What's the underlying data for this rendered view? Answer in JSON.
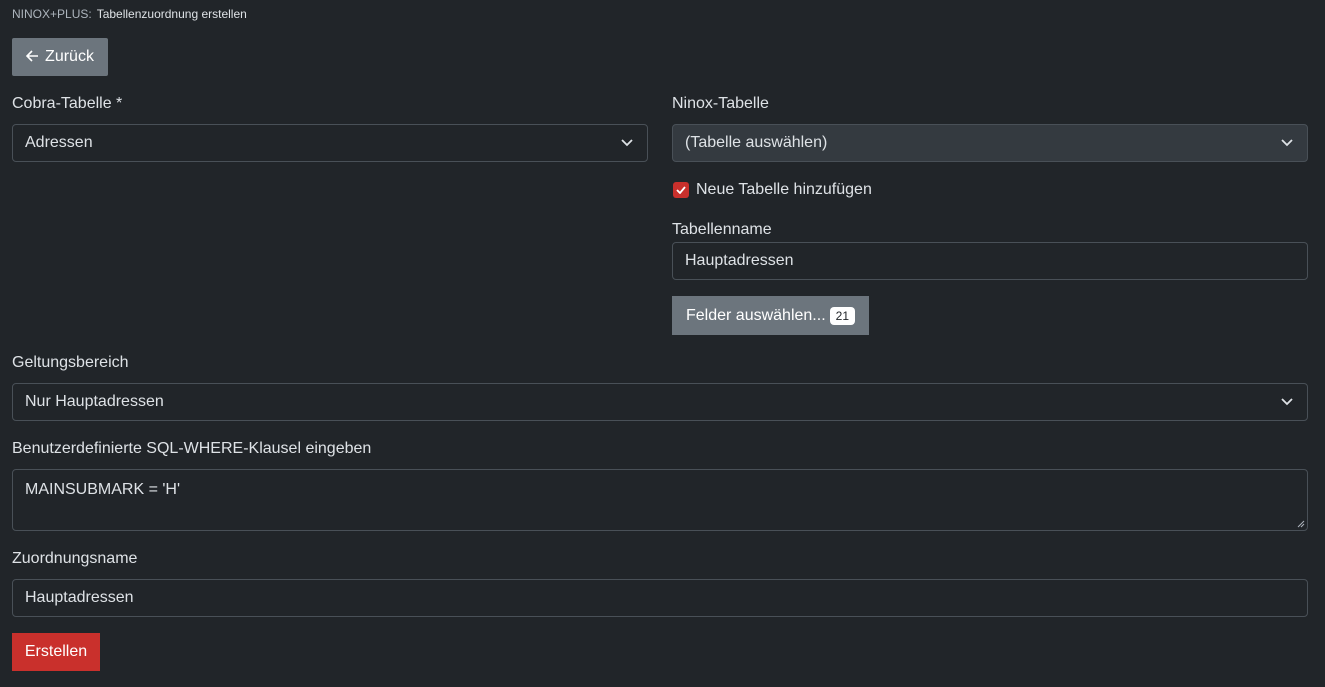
{
  "breadcrumb": {
    "app": "NINOX+PLUS:",
    "title": "Tabellenzuordnung erstellen"
  },
  "back_button": {
    "label": "Zurück",
    "icon": "arrow-left-icon"
  },
  "cobra_table": {
    "label": "Cobra-Tabelle *",
    "selected": "Adressen"
  },
  "ninox_table": {
    "label": "Ninox-Tabelle",
    "selected": "(Tabelle auswählen)"
  },
  "new_table_checkbox": {
    "label": "Neue Tabelle hinzufügen",
    "checked": true
  },
  "table_name": {
    "label": "Tabellenname",
    "value": "Hauptadressen"
  },
  "fields_button": {
    "label": "Felder auswählen...",
    "count": "21"
  },
  "scope": {
    "label": "Geltungsbereich",
    "selected": "Nur Hauptadressen"
  },
  "sql_where": {
    "label": "Benutzerdefinierte SQL-WHERE-Klausel eingeben",
    "value": "MAINSUBMARK = 'H'"
  },
  "mapping_name": {
    "label": "Zuordnungsname",
    "value": "Hauptadressen"
  },
  "create_button": {
    "label": "Erstellen"
  },
  "colors": {
    "background": "#212529",
    "secondary_button": "#6c757d",
    "accent_red": "#c9302c"
  }
}
